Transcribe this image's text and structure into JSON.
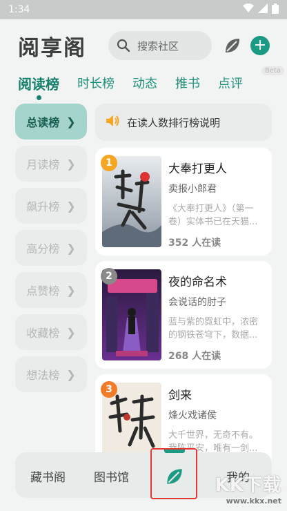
{
  "status": {
    "time": "1:34"
  },
  "header": {
    "title": "阅享阁",
    "search_placeholder": "搜索社区"
  },
  "tabs": [
    {
      "label": "阅读榜",
      "active": true
    },
    {
      "label": "时长榜"
    },
    {
      "label": "动态"
    },
    {
      "label": "推书"
    },
    {
      "label": "点评"
    }
  ],
  "beta_badge": "Beta",
  "sidebar": [
    {
      "label": "总读榜",
      "active": true
    },
    {
      "label": "月读榜"
    },
    {
      "label": "飙升榜"
    },
    {
      "label": "高分榜"
    },
    {
      "label": "点赞榜"
    },
    {
      "label": "收藏榜"
    },
    {
      "label": "想法榜"
    }
  ],
  "notice": "在读人数排行榜说明",
  "books": [
    {
      "rank": "1",
      "rank_color": "#f5a623",
      "title": "大奉打更人",
      "author": "卖报小郎君",
      "desc": "《大奉打更人》（第一卷）实体书已在天猫...",
      "readers": "352 人在读"
    },
    {
      "rank": "2",
      "rank_color": "#8a8a8a",
      "title": "夜的命名术",
      "author": "会说话的肘子",
      "desc": "蓝与紫的霓虹中，浓密的钢铁苍穹下，数据...",
      "readers": "268 人在读"
    },
    {
      "rank": "3",
      "rank_color": "#f07c2a",
      "title": "剑来",
      "author": "烽火戏诸侯",
      "desc": "大千世界，无奇不有。我陈平安，唯有一剑...",
      "readers": ""
    }
  ],
  "bottom_nav": {
    "item1": "藏书阁",
    "item2": "图书馆",
    "item4": "我的"
  },
  "watermark": {
    "big": "KK下载",
    "url": "www.kkx.net"
  },
  "colors": {
    "accent": "#1b9a84",
    "highlight": "#e53935"
  }
}
